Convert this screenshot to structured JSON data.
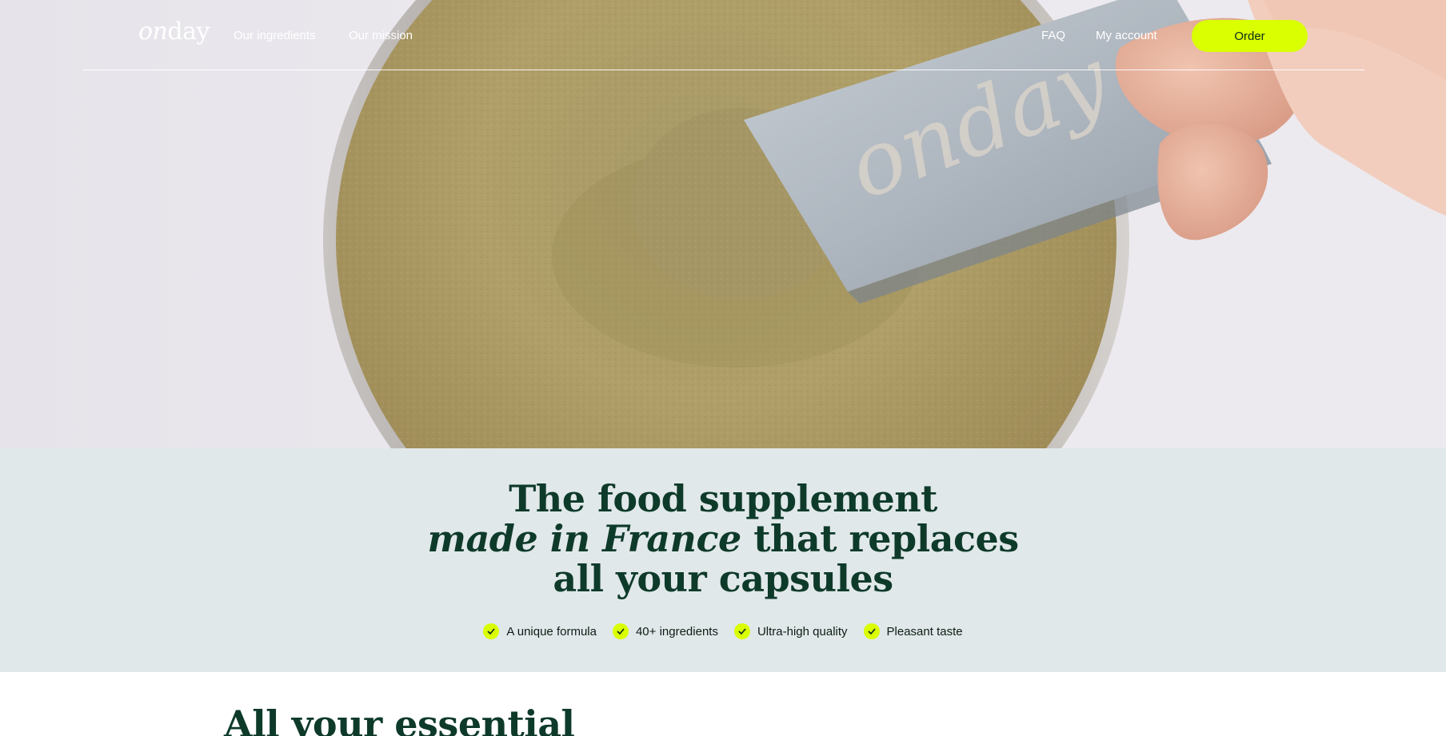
{
  "brand": {
    "logo_italic": "on",
    "logo_rest": "day"
  },
  "nav": {
    "ingredients": "Our ingredients",
    "mission": "Our mission",
    "faq": "FAQ",
    "account": "My account",
    "order": "Order"
  },
  "hero": {
    "headline_line1": "The food supplement",
    "headline_line2_italic": "made in France",
    "headline_line2_rest": " that replaces",
    "headline_line3": "all your capsules",
    "spoon_text": "onday"
  },
  "features": [
    {
      "label": "A unique formula"
    },
    {
      "label": "40+ ingredients"
    },
    {
      "label": "Ultra-high quality"
    },
    {
      "label": "Pleasant taste"
    }
  ],
  "section": {
    "title": "All your essential"
  },
  "colors": {
    "accent": "#d9ff00",
    "headline": "#0e3a2a",
    "band": "#e1e8e9"
  },
  "icons": {
    "check": "check-icon"
  }
}
